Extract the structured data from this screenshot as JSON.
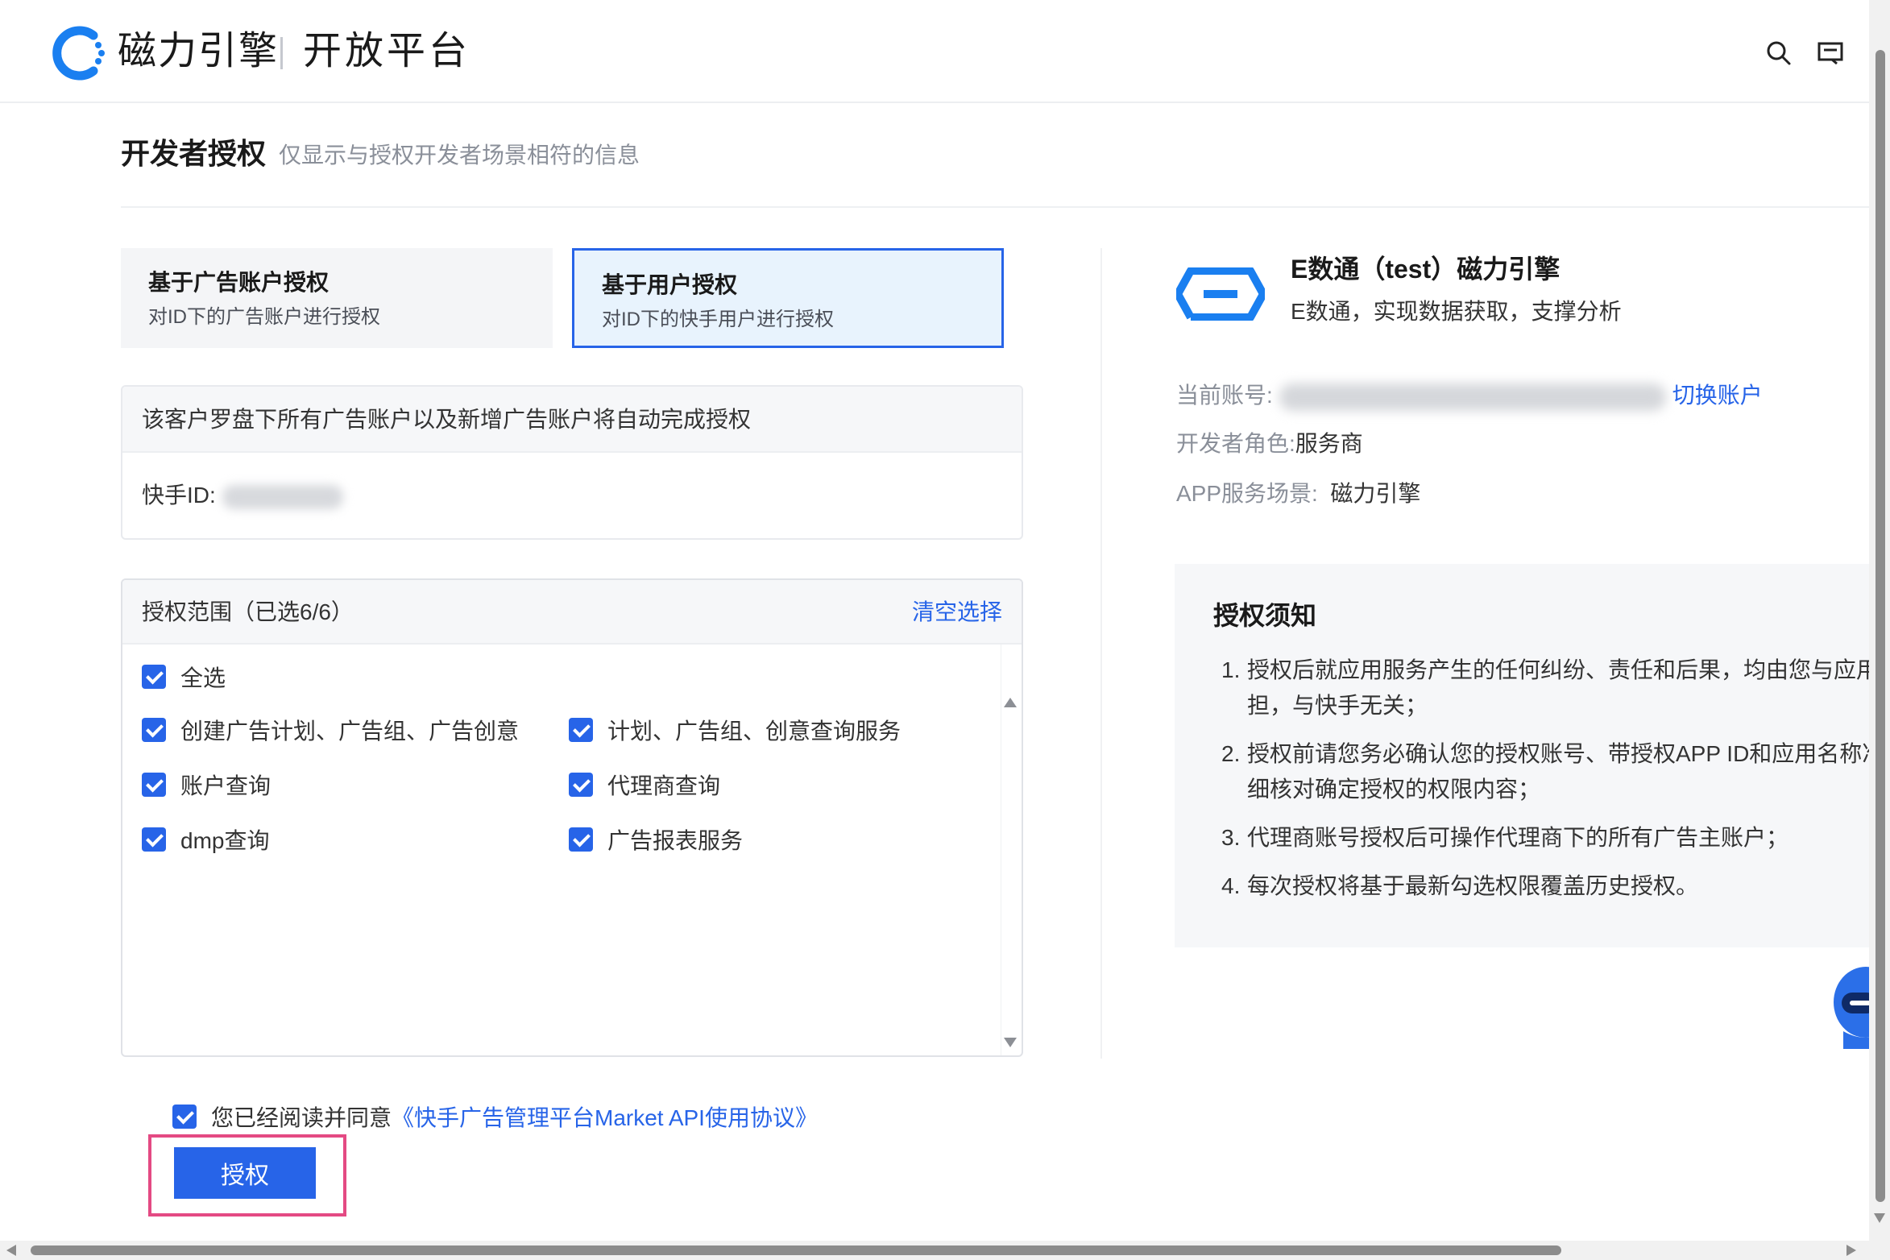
{
  "header": {
    "brand": "磁力引擎",
    "platform": "开放平台",
    "icons": [
      "search-icon",
      "message-icon"
    ]
  },
  "page": {
    "title": "开发者授权",
    "subtitle": "仅显示与授权开发者场景相符的信息"
  },
  "tabs": [
    {
      "title": "基于广告账户授权",
      "desc": "对ID下的广告账户进行授权",
      "active": false
    },
    {
      "title": "基于用户授权",
      "desc": "对ID下的快手用户进行授权",
      "active": true
    }
  ],
  "info_box": {
    "notice": "该客户罗盘下所有广告账户以及新增广告账户将自动完成授权",
    "id_label": "快手ID:"
  },
  "scope": {
    "title": "授权范围（已选6/6）",
    "clear_label": "清空选择",
    "select_all": "全选",
    "items": [
      {
        "label": "创建广告计划、广告组、广告创意",
        "checked": true
      },
      {
        "label": "计划、广告组、创意查询服务",
        "checked": true
      },
      {
        "label": "账户查询",
        "checked": true
      },
      {
        "label": "代理商查询",
        "checked": true
      },
      {
        "label": "dmp查询",
        "checked": true
      },
      {
        "label": "广告报表服务",
        "checked": true
      }
    ]
  },
  "agreement": {
    "text": "您已经阅读并同意",
    "link": "《快手广告管理平台Market API使用协议》",
    "checked": true
  },
  "authorize_button": "授权",
  "app": {
    "name": "E数通（test）磁力引擎",
    "desc": "E数通，实现数据获取，支撑分析",
    "current_account_label": "当前账号:",
    "switch_account": "切换账户",
    "role_label": "开发者角色:",
    "role_value": "服务商",
    "scene_label": "APP服务场景:",
    "scene_value": "磁力引擎"
  },
  "notice": {
    "title": "授权须知",
    "items": [
      {
        "num": "1.",
        "lines": [
          "授权后就应用服务产生的任何纠纷、责任和后果，均由您与应用",
          "担，与快手无关；"
        ]
      },
      {
        "num": "2.",
        "lines": [
          "授权前请您务必确认您的授权账号、带授权APP ID和应用名称准",
          "细核对确定授权的权限内容；"
        ]
      },
      {
        "num": "3.",
        "lines": [
          "代理商账号授权后可操作代理商下的所有广告主账户；"
        ]
      },
      {
        "num": "4.",
        "lines": [
          "每次授权将基于最新勾选权限覆盖历史授权。"
        ]
      }
    ]
  },
  "colors": {
    "accent": "#2764e8",
    "highlight": "#e44a83",
    "muted": "#8a8f99"
  }
}
